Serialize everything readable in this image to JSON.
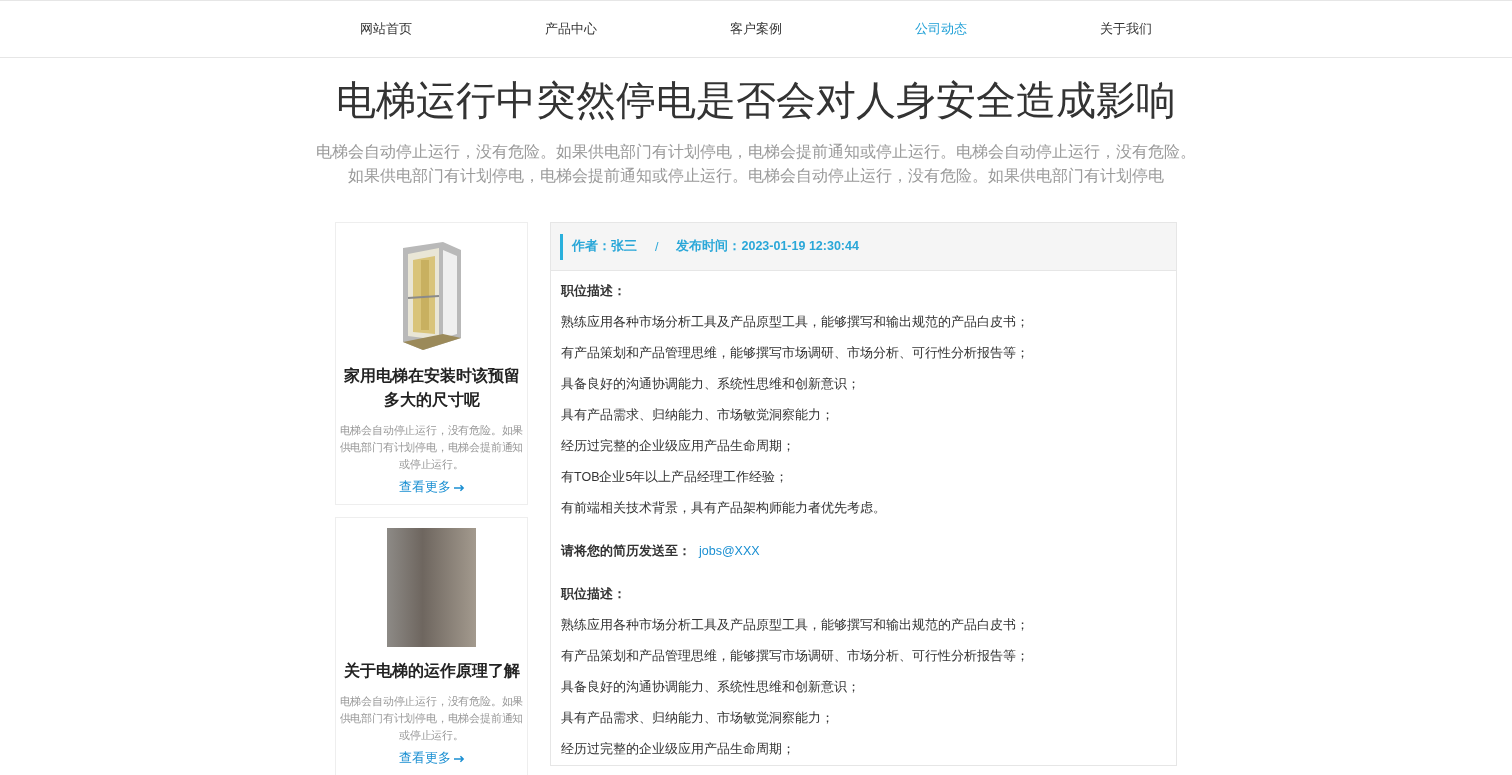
{
  "nav": [
    {
      "label": "网站首页",
      "selected": false
    },
    {
      "label": "产品中心",
      "selected": false
    },
    {
      "label": "客户案例",
      "selected": false
    },
    {
      "label": "公司动态",
      "selected": true
    },
    {
      "label": "关于我们",
      "selected": false
    }
  ],
  "article": {
    "title": "电梯运行中突然停电是否会对人身安全造成影响",
    "summary": "电梯会自动停止运行，没有危险。如果供电部门有计划停电，电梯会提前通知或停止运行。电梯会自动停止运行，没有危险。如果供电部门有计划停电，电梯会提前通知或停止运行。电梯会自动停止运行，没有危险。如果供电部门有计划停电"
  },
  "sidebar": {
    "cards": [
      {
        "kind": "drawing",
        "title": "家用电梯在安装时该预留多大的尺寸呢",
        "description": "电梯会自动停止运行，没有危险。如果供电部门有计划停电，电梯会提前通知或停止运行。",
        "link": "查看更多"
      },
      {
        "kind": "photo",
        "title": "关于电梯的运作原理了解",
        "description": "电梯会自动停止运行，没有危险。如果供电部门有计划停电，电梯会提前通知或停止运行。",
        "link": "查看更多"
      }
    ]
  },
  "meta": {
    "author": "作者：张三",
    "separator": "/",
    "published": "发布时间：2023-01-19 12:30:44"
  },
  "body": [
    {
      "kind": "heading",
      "text": "职位描述："
    },
    {
      "kind": "line",
      "text": "熟练应用各种市场分析工具及产品原型工具，能够撰写和输出规范的产品白皮书；"
    },
    {
      "kind": "line",
      "text": "有产品策划和产品管理思维，能够撰写市场调研、市场分析、可行性分析报告等；"
    },
    {
      "kind": "line",
      "text": "具备良好的沟通协调能力、系统性思维和创新意识；"
    },
    {
      "kind": "line",
      "text": "具有产品需求、归纳能力、市场敏觉洞察能力；"
    },
    {
      "kind": "line",
      "text": "经历过完整的企业级应用产品生命周期；"
    },
    {
      "kind": "line",
      "text": "有TOB企业5年以上产品经理工作经验；"
    },
    {
      "kind": "line",
      "text": "有前端相关技术背景，具有产品架构师能力者优先考虑。"
    },
    {
      "kind": "contact",
      "text": "请将您的简历发送至：",
      "link": "jobs@XXX"
    },
    {
      "kind": "heading",
      "text": "职位描述："
    },
    {
      "kind": "line",
      "text": "熟练应用各种市场分析工具及产品原型工具，能够撰写和输出规范的产品白皮书；"
    },
    {
      "kind": "line",
      "text": "有产品策划和产品管理思维，能够撰写市场调研、市场分析、可行性分析报告等；"
    },
    {
      "kind": "line",
      "text": "具备良好的沟通协调能力、系统性思维和创新意识；"
    },
    {
      "kind": "line",
      "text": "具有产品需求、归纳能力、市场敏觉洞察能力；"
    },
    {
      "kind": "line",
      "text": "经历过完整的企业级应用产品生命周期；"
    }
  ]
}
